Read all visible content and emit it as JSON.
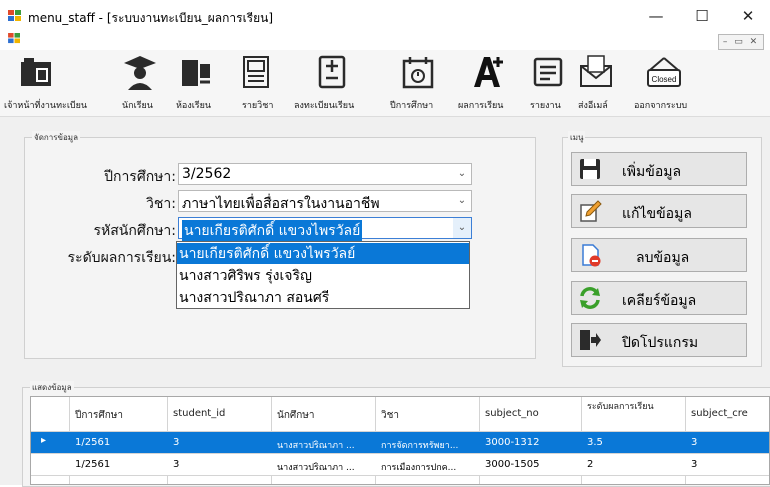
{
  "window": {
    "title": "menu_staff - [ระบบงานทะเบียน_ผลการเรียน]",
    "minimize": "—",
    "maximize": "☐",
    "close": "✕",
    "mdi_controls": "– ▭ ✕"
  },
  "toolbar": {
    "items": [
      {
        "label": "เจ้าหน้าที่งานทะเบียน",
        "icon": "building-icon"
      },
      {
        "label": "นักเรียน",
        "icon": "graduate-icon"
      },
      {
        "label": "ห้องเรียน",
        "icon": "classroom-icon"
      },
      {
        "label": "รายวิชา",
        "icon": "book-icon"
      },
      {
        "label": "ลงทะเบียนเรียน",
        "icon": "register-icon"
      },
      {
        "label": "ปีการศึกษา",
        "icon": "calendar-icon"
      },
      {
        "label": "ผลการเรียน",
        "icon": "grade-icon"
      },
      {
        "label": "รายงาน",
        "icon": "report-icon"
      },
      {
        "label": "ส่งอีเมล์",
        "icon": "email-icon"
      },
      {
        "label": "ออกจากระบบ",
        "icon": "closed-sign-icon"
      }
    ],
    "closed_sign_text": "Closed"
  },
  "form": {
    "group_title": "จัดการข้อมูล",
    "year_label": "ปีการศึกษา:",
    "year_value": "3/2562",
    "subject_label": "วิชา:",
    "subject_value": "ภาษาไทยเพื่อสื่อสารในงานอาชีพ",
    "student_label": "รหัสนักศึกษา:",
    "student_value": "นายเกียรติศักดิ์ แขวงไพรวัลย์",
    "grade_label": "ระดับผลการเรียน:",
    "dropdown_options": [
      "นายเกียรติศักดิ์ แขวงไพรวัลย์",
      "นางสาวศิริพร รุ่งเจริญ",
      "นางสาวปริณาภา สอนศรี"
    ]
  },
  "menu": {
    "group_title": "เมนู",
    "buttons": [
      {
        "label": "เพิ่มข้อมูล",
        "icon": "save-icon"
      },
      {
        "label": "แก้ไขข้อมูล",
        "icon": "edit-icon"
      },
      {
        "label": "ลบข้อมูล",
        "icon": "delete-icon"
      },
      {
        "label": "เคลียร์ข้อมูล",
        "icon": "refresh-icon"
      },
      {
        "label": "ปิดโปรแกรม",
        "icon": "exit-icon"
      }
    ]
  },
  "grid": {
    "group_title": "แสดงข้อมูล",
    "columns": [
      "ปีการศึกษา",
      "student_id",
      "นักศึกษา",
      "วิชา",
      "subject_no",
      "ระดับผลการเรียน",
      "subject_cre"
    ],
    "rows": [
      [
        "1/2561",
        "3",
        "นางสาวปริณาภา ...",
        "การจัดการทรัพยา...",
        "3000-1312",
        "3.5",
        "3"
      ],
      [
        "1/2561",
        "3",
        "นางสาวปริณาภา ...",
        "การเมืองการปกค...",
        "3000-1505",
        "2",
        "3"
      ]
    ],
    "selected_row_indicator": "▸"
  },
  "colors": {
    "selection": "#0a78d7",
    "dropdown_highlight": "#0a78d7",
    "button_face": "#e6e6e6",
    "panel": "#f0f0f0"
  }
}
